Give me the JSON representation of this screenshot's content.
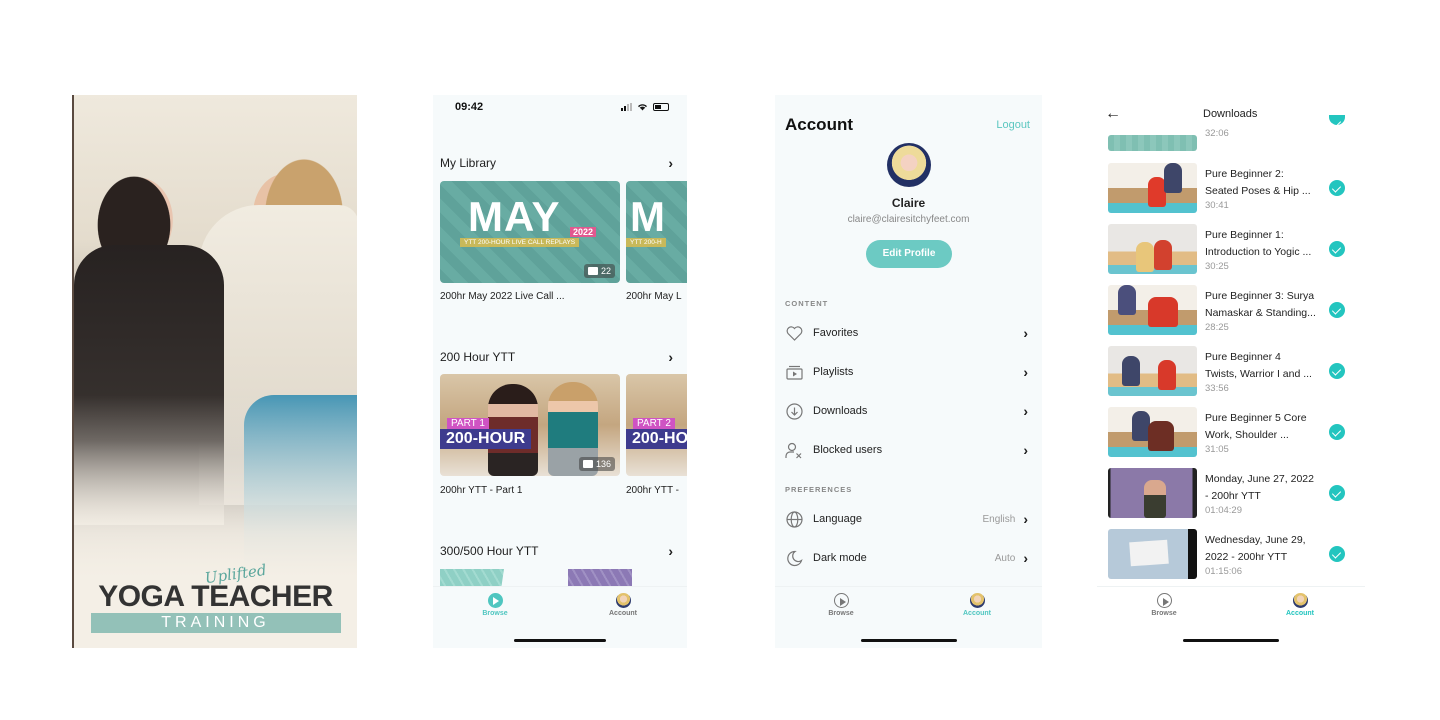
{
  "splash": {
    "logo_script": "Uplifted",
    "logo_main": "YOGA TEACHER",
    "logo_band": "TRAINING"
  },
  "browse": {
    "status_time": "09:42",
    "sections": [
      {
        "title": "My Library",
        "cards": [
          {
            "title": "200hr May 2022 Live Call ...",
            "count": "22",
            "art_main": "MAY",
            "art_year": "2022",
            "art_band": "YTT 200-HOUR LIVE CALL REPLAYS"
          },
          {
            "title": "200hr May L",
            "art_main": "M",
            "art_band": "YTT 200-H"
          }
        ]
      },
      {
        "title": "200 Hour YTT",
        "cards": [
          {
            "title": "200hr YTT - Part 1",
            "count": "136",
            "art_part": "PART 1",
            "art_hour": "200-HOUR"
          },
          {
            "title": "200hr YTT -",
            "art_part": "PART 2",
            "art_hour": "200-HO"
          }
        ]
      },
      {
        "title": "300/500 Hour YTT"
      }
    ],
    "tabs": [
      {
        "label": "Browse",
        "active": true
      },
      {
        "label": "Account",
        "active": false
      }
    ]
  },
  "account": {
    "title": "Account",
    "logout_label": "Logout",
    "user_name": "Claire",
    "user_email": "claire@clairesitchyfeet.com",
    "edit_profile_label": "Edit Profile",
    "content_label": "CONTENT",
    "content_items": [
      {
        "label": "Favorites",
        "icon": "heart-icon"
      },
      {
        "label": "Playlists",
        "icon": "playlist-icon"
      },
      {
        "label": "Downloads",
        "icon": "download-icon"
      },
      {
        "label": "Blocked users",
        "icon": "blocked-user-icon"
      }
    ],
    "preferences_label": "PREFERENCES",
    "preference_items": [
      {
        "label": "Language",
        "value": "English",
        "icon": "globe-icon"
      },
      {
        "label": "Dark mode",
        "value": "Auto",
        "icon": "moon-icon"
      }
    ],
    "tabs": [
      {
        "label": "Browse",
        "active": false
      },
      {
        "label": "Account",
        "active": true
      }
    ]
  },
  "downloads": {
    "title": "Downloads",
    "partial_item_duration": "32:06",
    "items": [
      {
        "title_line1": "Pure Beginner 2:",
        "title_line2": "Seated Poses & Hip ...",
        "duration": "30:41"
      },
      {
        "title_line1": "Pure Beginner 1:",
        "title_line2": "Introduction to Yogic ...",
        "duration": "30:25"
      },
      {
        "title_line1": "Pure Beginner 3: Surya",
        "title_line2": "Namaskar & Standing...",
        "duration": "28:25"
      },
      {
        "title_line1": "Pure Beginner 4",
        "title_line2": "Twists, Warrior I and ...",
        "duration": "33:56"
      },
      {
        "title_line1": "Pure Beginner 5 Core",
        "title_line2": "Work, Shoulder ...",
        "duration": "31:05"
      },
      {
        "title_line1": "Monday, June 27, 2022",
        "title_line2": "- 200hr YTT",
        "duration": "01:04:29"
      },
      {
        "title_line1": "Wednesday, June 29,",
        "title_line2": "2022 - 200hr YTT",
        "duration": "01:15:06"
      }
    ],
    "tabs": [
      {
        "label": "Browse",
        "active": false
      },
      {
        "label": "Account",
        "active": true
      }
    ]
  },
  "colors": {
    "accent": "#4fc6c0",
    "check": "#23c5bf",
    "edit_button": "#6ccac3"
  }
}
